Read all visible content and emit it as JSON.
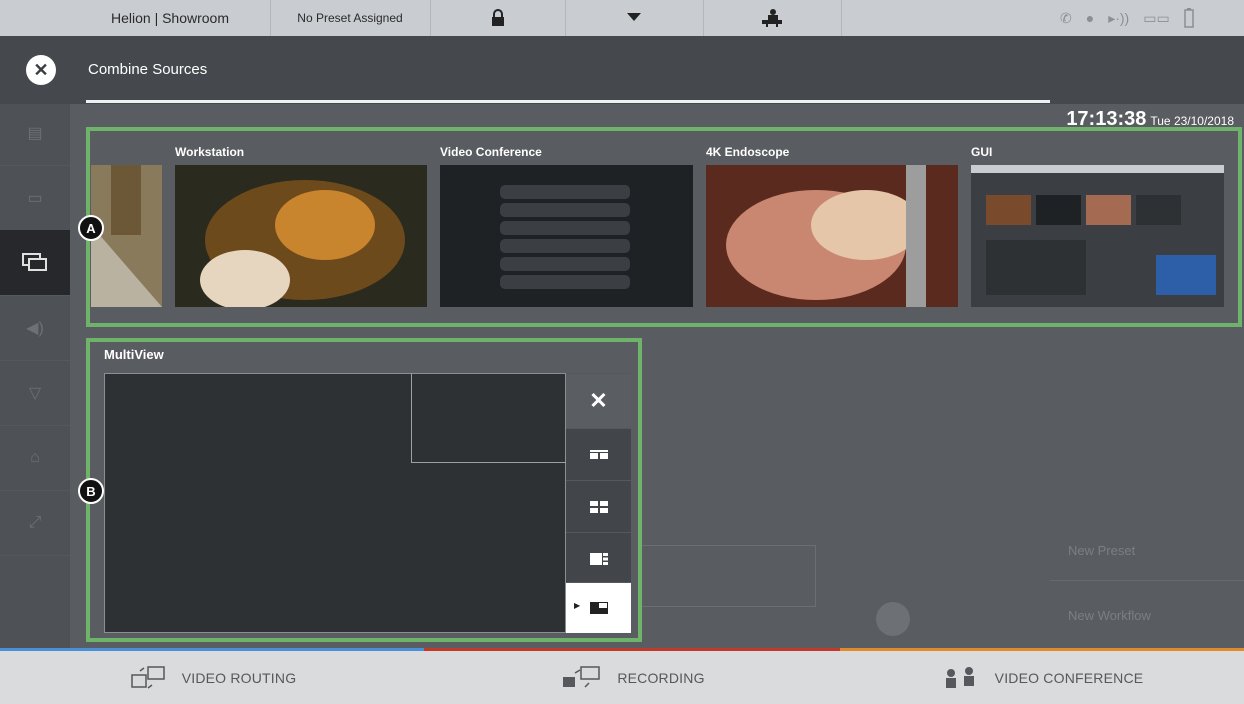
{
  "topbar": {
    "site": "Helion | Showroom",
    "preset": "No Preset Assigned",
    "icons": [
      "lock-icon",
      "dropdown-caret-icon",
      "surgery-table-icon",
      "phone-icon",
      "record-dot-icon",
      "broadcast-icon",
      "glasses-icon",
      "battery-icon"
    ]
  },
  "modal": {
    "title": "Combine Sources",
    "close_icon": "close-icon"
  },
  "clock": {
    "time": "17:13:38",
    "date": "Tue 23/10/2018"
  },
  "sources": [
    {
      "label": "Workstation"
    },
    {
      "label": "Video Conference"
    },
    {
      "label": "4K Endoscope"
    },
    {
      "label": "GUI"
    }
  ],
  "callouts": {
    "a": "A",
    "b": "B"
  },
  "multiview": {
    "label": "MultiView",
    "layouts": [
      {
        "icon": "close-icon",
        "glyph": "✕"
      },
      {
        "icon": "layout-side-by-side-icon"
      },
      {
        "icon": "layout-quad-icon"
      },
      {
        "icon": "layout-main-side-icon"
      },
      {
        "icon": "layout-pip-icon",
        "selected": true
      }
    ]
  },
  "background": {
    "new_preset": "New Preset",
    "new_workflow": "New Workflow",
    "sidebar_icons": [
      "clipboard-icon",
      "screens-icon",
      "monitor-icon",
      "speaker-icon",
      "lamp-icon",
      "table-icon",
      "fullscreen-icon"
    ]
  },
  "bottomnav": {
    "tabs": [
      {
        "label": "VIDEO ROUTING",
        "color": "#4a90d9"
      },
      {
        "label": "RECORDING",
        "color": "#c0392b"
      },
      {
        "label": "VIDEO CONFERENCE",
        "color": "#e08a2c"
      }
    ]
  }
}
